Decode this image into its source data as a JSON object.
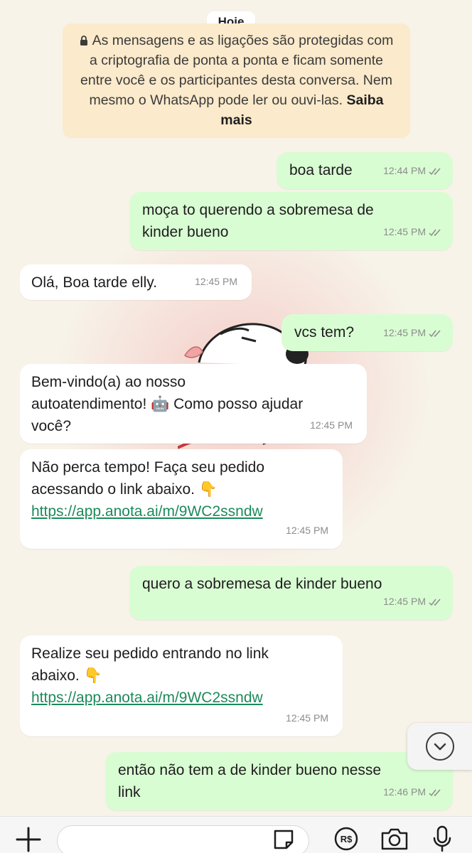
{
  "date_chip": "Hoje",
  "encryption_notice": {
    "text": "As mensagens e as ligações são protegidas com a criptografia de ponta a ponta e ficam somente entre você e os participantes desta conversa. Nem mesmo o WhatsApp pode ler ou ouvi-las.",
    "link": "Saiba mais"
  },
  "messages": [
    {
      "direction": "out",
      "lines": [
        "boa tarde"
      ],
      "time": "12:44 PM",
      "status": "read"
    },
    {
      "direction": "out",
      "lines": [
        "moça to querendo a sobremesa de",
        "kinder bueno"
      ],
      "time": "12:45 PM",
      "status": "read"
    },
    {
      "direction": "in",
      "lines": [
        "Olá, Boa tarde elly."
      ],
      "time": "12:45 PM"
    },
    {
      "direction": "out",
      "lines": [
        "vcs tem?"
      ],
      "time": "12:45 PM",
      "status": "read"
    },
    {
      "direction": "in",
      "lines": [
        "Bem-vindo(a) ao nosso",
        "autoatendimento! 🤖 Como posso ajudar",
        "você?"
      ],
      "time": "12:45 PM"
    },
    {
      "direction": "in",
      "lines": [
        "Não perca tempo! Faça seu pedido",
        "acessando o link abaixo. 👇"
      ],
      "link": "https://app.anota.ai/m/9WC2ssndw",
      "time": "12:45 PM"
    },
    {
      "direction": "out",
      "lines": [
        "quero a sobremesa de kinder bueno"
      ],
      "time": "12:45 PM",
      "status": "read"
    },
    {
      "direction": "in",
      "lines": [
        "Realize seu pedido entrando no link",
        "abaixo. 👇"
      ],
      "link": "https://app.anota.ai/m/9WC2ssndw",
      "time": "12:45 PM"
    },
    {
      "direction": "out",
      "lines": [
        "então não tem a de kinder bueno nesse",
        "link"
      ],
      "time": "12:46 PM",
      "status": "read"
    }
  ],
  "composer": {
    "input_value": "",
    "icons": [
      "plus-icon",
      "sticker-icon",
      "payment-icon",
      "camera-icon",
      "microphone-icon"
    ],
    "pay_symbol": "R$"
  },
  "colors": {
    "background": "#f7f3e8",
    "outgoing_bubble": "#d9fdd3",
    "incoming_bubble": "#ffffff",
    "notice_bg": "#fbeacb",
    "link": "#1c8a5b"
  }
}
